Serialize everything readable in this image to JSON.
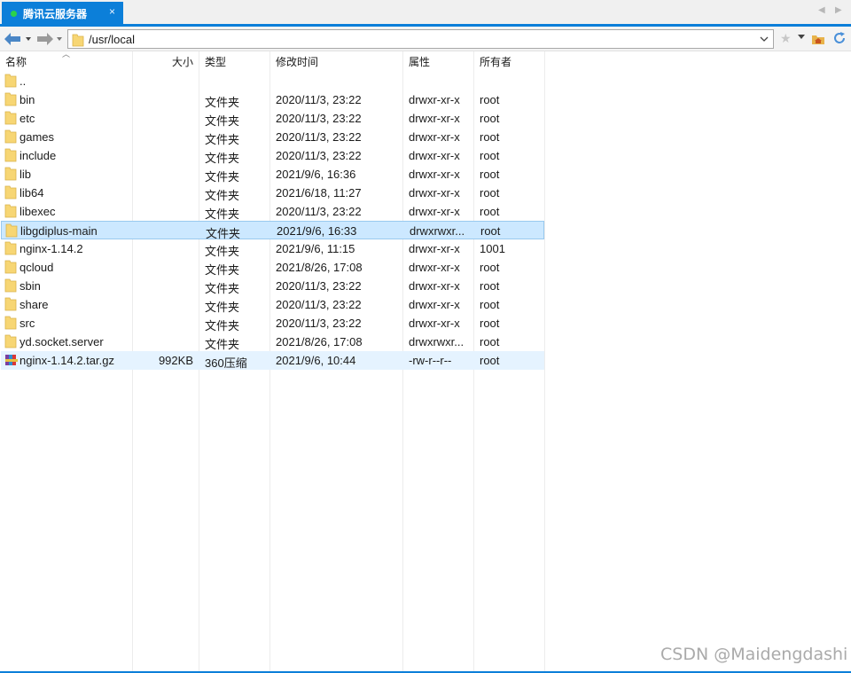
{
  "tab": {
    "title": "腾讯云服务器",
    "close": "×"
  },
  "tab_scroll": {
    "left": "◀",
    "right": "▶"
  },
  "address": {
    "path": "/usr/local"
  },
  "columns": {
    "name": "名称",
    "size": "大小",
    "type": "类型",
    "mtime": "修改时间",
    "perm": "属性",
    "owner": "所有者"
  },
  "rows": [
    {
      "icon": "folder-icon",
      "name": "..",
      "size": "",
      "type": "",
      "mtime": "",
      "perm": "",
      "owner": ""
    },
    {
      "icon": "folder-icon",
      "name": "bin",
      "size": "",
      "type": "文件夹",
      "mtime": "2020/11/3, 23:22",
      "perm": "drwxr-xr-x",
      "owner": "root"
    },
    {
      "icon": "folder-icon",
      "name": "etc",
      "size": "",
      "type": "文件夹",
      "mtime": "2020/11/3, 23:22",
      "perm": "drwxr-xr-x",
      "owner": "root"
    },
    {
      "icon": "folder-icon",
      "name": "games",
      "size": "",
      "type": "文件夹",
      "mtime": "2020/11/3, 23:22",
      "perm": "drwxr-xr-x",
      "owner": "root"
    },
    {
      "icon": "folder-icon",
      "name": "include",
      "size": "",
      "type": "文件夹",
      "mtime": "2020/11/3, 23:22",
      "perm": "drwxr-xr-x",
      "owner": "root"
    },
    {
      "icon": "folder-icon",
      "name": "lib",
      "size": "",
      "type": "文件夹",
      "mtime": "2021/9/6, 16:36",
      "perm": "drwxr-xr-x",
      "owner": "root"
    },
    {
      "icon": "folder-icon",
      "name": "lib64",
      "size": "",
      "type": "文件夹",
      "mtime": "2021/6/18, 11:27",
      "perm": "drwxr-xr-x",
      "owner": "root"
    },
    {
      "icon": "folder-icon",
      "name": "libexec",
      "size": "",
      "type": "文件夹",
      "mtime": "2020/11/3, 23:22",
      "perm": "drwxr-xr-x",
      "owner": "root"
    },
    {
      "icon": "folder-icon",
      "name": "libgdiplus-main",
      "size": "",
      "type": "文件夹",
      "mtime": "2021/9/6, 16:33",
      "perm": "drwxrwxr...",
      "owner": "root",
      "state": "selected"
    },
    {
      "icon": "folder-icon",
      "name": "nginx-1.14.2",
      "size": "",
      "type": "文件夹",
      "mtime": "2021/9/6, 11:15",
      "perm": "drwxr-xr-x",
      "owner": "1001"
    },
    {
      "icon": "folder-icon",
      "name": "qcloud",
      "size": "",
      "type": "文件夹",
      "mtime": "2021/8/26, 17:08",
      "perm": "drwxr-xr-x",
      "owner": "root"
    },
    {
      "icon": "folder-icon",
      "name": "sbin",
      "size": "",
      "type": "文件夹",
      "mtime": "2020/11/3, 23:22",
      "perm": "drwxr-xr-x",
      "owner": "root"
    },
    {
      "icon": "folder-icon",
      "name": "share",
      "size": "",
      "type": "文件夹",
      "mtime": "2020/11/3, 23:22",
      "perm": "drwxr-xr-x",
      "owner": "root"
    },
    {
      "icon": "folder-icon",
      "name": "src",
      "size": "",
      "type": "文件夹",
      "mtime": "2020/11/3, 23:22",
      "perm": "drwxr-xr-x",
      "owner": "root"
    },
    {
      "icon": "folder-icon",
      "name": "yd.socket.server",
      "size": "",
      "type": "文件夹",
      "mtime": "2021/8/26, 17:08",
      "perm": "drwxrwxr...",
      "owner": "root"
    },
    {
      "icon": "archive-icon",
      "name": "nginx-1.14.2.tar.gz",
      "size": "992KB",
      "type": "360压缩",
      "mtime": "2021/9/6, 10:44",
      "perm": "-rw-r--r--",
      "owner": "root",
      "state": "hovered"
    }
  ],
  "colors": {
    "accent": "#0c7fd9",
    "selection": "#cce8ff",
    "selection_border": "#99c9ef",
    "hover": "#e5f3ff",
    "folder": "#f7d674"
  },
  "watermark": "CSDN @Maidengdashi"
}
